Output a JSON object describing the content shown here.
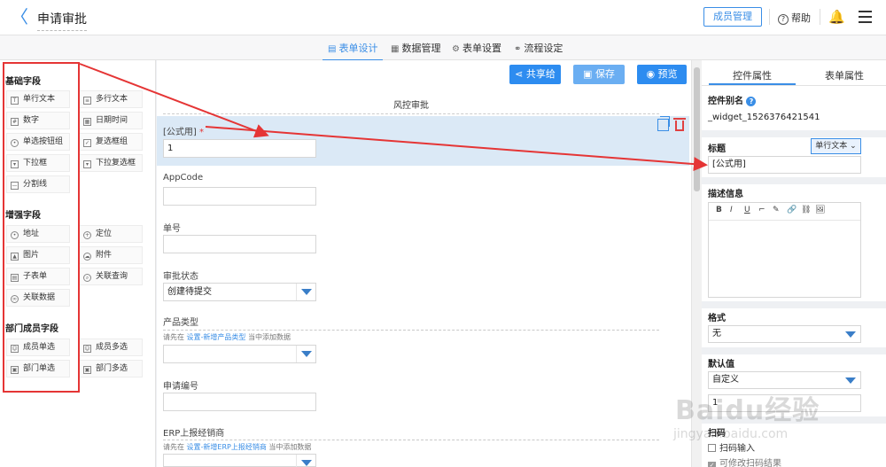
{
  "header": {
    "back_label": "〈",
    "title": "申请审批",
    "member_button": "成员管理",
    "help_label": "帮助"
  },
  "tabs": [
    {
      "label": "表单设计",
      "icon": "form-icon",
      "active": true
    },
    {
      "label": "数据管理",
      "icon": "database-icon",
      "active": false
    },
    {
      "label": "表单设置",
      "icon": "settings-icon",
      "active": false
    },
    {
      "label": "流程设定",
      "icon": "flow-icon",
      "active": false
    }
  ],
  "palette": {
    "basic_title": "基础字段",
    "basic": [
      "单行文本",
      "多行文本",
      "数字",
      "日期时间",
      "单选按钮组",
      "复选框组",
      "下拉框",
      "下拉复选框",
      "分割线"
    ],
    "enhanced_title": "增强字段",
    "enhanced": [
      "地址",
      "定位",
      "图片",
      "附件",
      "子表单",
      "关联查询",
      "关联数据"
    ],
    "dept_title": "部门成员字段",
    "dept": [
      "成员单选",
      "成员多选",
      "部门单选",
      "部门多选"
    ]
  },
  "toolbar": {
    "share": "共享给",
    "save": "保存",
    "preview": "预览",
    "share_color": "#2d8cf0",
    "save_color": "#6aaef2",
    "preview_color": "#2d8cf0"
  },
  "form": {
    "title": "风控审批",
    "fields": {
      "formula_label": "[公式用]",
      "formula_required": "*",
      "formula_value": "1",
      "appcode_label": "AppCode",
      "appcode_value": "",
      "number_label": "单号",
      "number_value": "",
      "status_label": "审批状态",
      "status_value": "创建待提交",
      "product_label": "产品类型",
      "product_hint_pre": "请先在",
      "product_hint_link": "设置-新增产品类型",
      "product_hint_post": "当中添加数据",
      "product_value": "",
      "apply_no_label": "申请编号",
      "apply_no_value": "",
      "erp_label": "ERP上报经销商",
      "erp_hint_pre": "请先在",
      "erp_hint_link": "设置-新增ERP上报经销商",
      "erp_hint_post": "当中添加数据",
      "erp_value": ""
    }
  },
  "right_panel": {
    "tab_control": "控件属性",
    "tab_form": "表单属性",
    "alias_label": "控件别名",
    "alias_value": "_widget_1526376421541",
    "title_label": "标题",
    "type_button": "单行文本",
    "title_value": "[公式用]",
    "desc_label": "描述信息",
    "editor_tools": [
      "B",
      "I",
      "U",
      "⌐",
      "✎",
      "🔗",
      "⛓",
      "🖼"
    ],
    "format_label": "格式",
    "format_value": "无",
    "default_label": "默认值",
    "default_mode": "自定义",
    "default_value": "1",
    "scan_label": "扫码",
    "scan_input": "扫码输入",
    "scan_modify": "可修改扫码结果"
  },
  "watermark": {
    "text": "Baidu经验",
    "url": "jingyan.baidu.com"
  },
  "accent_color": "#3a8ee6",
  "annotation_color": "#e53535"
}
